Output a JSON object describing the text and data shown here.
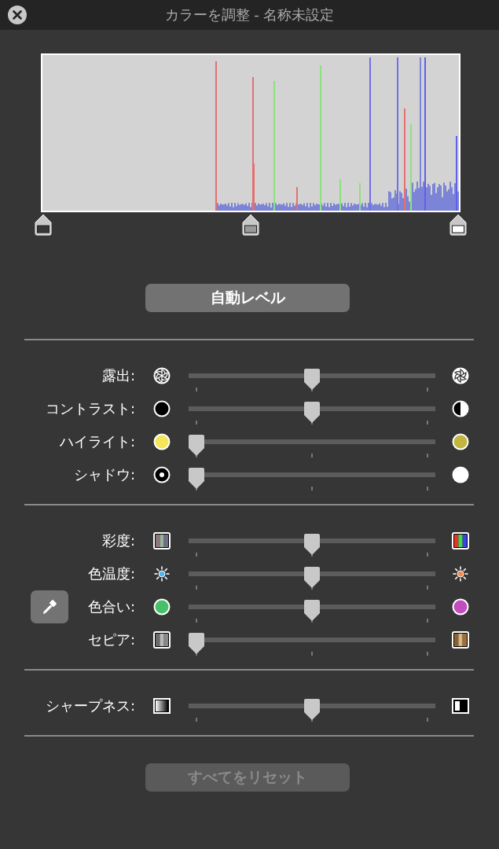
{
  "window": {
    "title": "カラーを調整 - 名称未設定"
  },
  "levels": {
    "handles": [
      {
        "kind": "black"
      },
      {
        "kind": "mid"
      },
      {
        "kind": "white"
      }
    ]
  },
  "auto_levels_button": {
    "label": "自動レベル",
    "disabled": false
  },
  "groups": [
    {
      "sliders": [
        {
          "label": "露出:",
          "level": 0.5
        },
        {
          "label": "コントラスト:",
          "level": 0.5
        },
        {
          "label": "ハイライト:",
          "level": 0
        },
        {
          "label": "シャドウ:",
          "level": 0
        }
      ]
    },
    {
      "sliders": [
        {
          "label": "彩度:",
          "level": 0.5,
          "eyedropper": false
        },
        {
          "label": "色温度:",
          "level": 0.5,
          "eyedropper": false
        },
        {
          "label": "色合い:",
          "level": 0.5,
          "eyedropper": true
        },
        {
          "label": "セピア:",
          "level": 0,
          "eyedropper": false
        }
      ]
    },
    {
      "sliders": [
        {
          "label": "シャープネス:",
          "level": 0.5
        }
      ]
    }
  ],
  "reset_button": {
    "label": "すべてをリセット",
    "disabled": true
  }
}
